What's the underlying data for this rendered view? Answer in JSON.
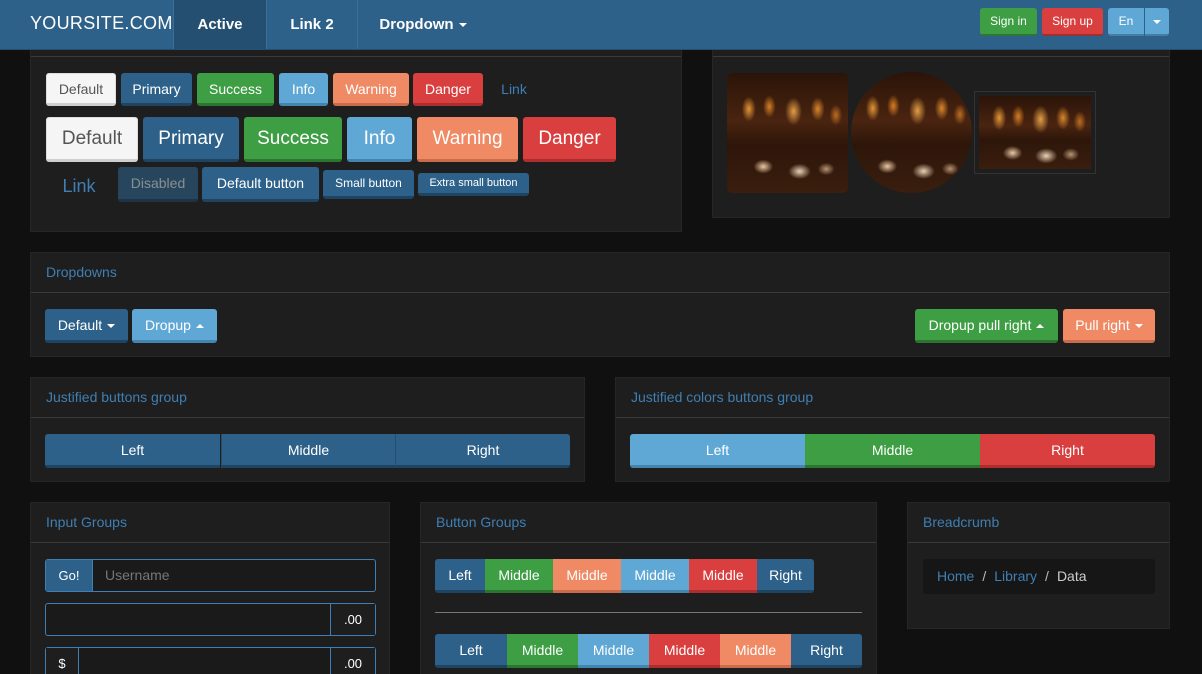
{
  "navbar": {
    "brand": "YOURSITE.COM",
    "items": [
      "Active",
      "Link 2",
      "Dropdown"
    ],
    "signin": "Sign in",
    "signup": "Sign up",
    "lang": "En"
  },
  "buttons": {
    "row1": [
      "Default",
      "Primary",
      "Success",
      "Info",
      "Warning",
      "Danger",
      "Link"
    ],
    "row2": [
      "Default",
      "Primary",
      "Success",
      "Info",
      "Warning",
      "Danger"
    ],
    "row3": [
      "Link",
      "Disabled",
      "Default button",
      "Small button",
      "Extra small button"
    ]
  },
  "dropdowns": {
    "title": "Dropdowns",
    "default": "Default",
    "dropup": "Dropup",
    "dropup_right": "Dropup pull right",
    "pull_right": "Pull right"
  },
  "justified": {
    "title": "Justified buttons group",
    "items": [
      "Left",
      "Middle",
      "Right"
    ]
  },
  "justified_colors": {
    "title": "Justified colors buttons group",
    "items": [
      "Left",
      "Middle",
      "Right"
    ]
  },
  "input_groups": {
    "title": "Input Groups",
    "go": "Go!",
    "username_placeholder": "Username",
    "suffix": ".00",
    "dollar": "$"
  },
  "button_groups": {
    "title": "Button Groups",
    "row1": [
      "Left",
      "Middle",
      "Middle",
      "Middle",
      "Middle",
      "Right"
    ],
    "row2": [
      "Left",
      "Middle",
      "Middle",
      "Middle",
      "Middle",
      "Right"
    ]
  },
  "breadcrumb": {
    "title": "Breadcrumb",
    "items": [
      "Home",
      "Library",
      "Data"
    ]
  },
  "colors": {
    "primary": "#2e6189",
    "success": "#3e9e44",
    "info": "#5fa8d6",
    "warning": "#ef8a65",
    "danger": "#d93f3f"
  }
}
